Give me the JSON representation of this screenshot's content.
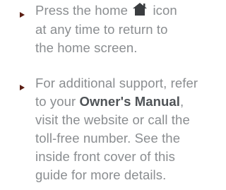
{
  "bullets": [
    {
      "line1_before_icon": "Press the home ",
      "icon": "home-icon",
      "line1_after_icon": " icon",
      "line2": "at any time to return to",
      "line3": "the home screen."
    },
    {
      "line1": "For additional support, refer",
      "line2_before": "to your ",
      "line2_bold": "Owner's Manual",
      "line2_after": ",",
      "line3": "visit the website or call the",
      "line4": "toll-free number. See the",
      "line5": "inside front cover of this",
      "line6": "guide for more details."
    }
  ],
  "colors": {
    "text": "#8a8d90",
    "bold_text": "#4f5357",
    "bullet_arrow": "#5c1f14",
    "icon": "#3a3d40"
  }
}
